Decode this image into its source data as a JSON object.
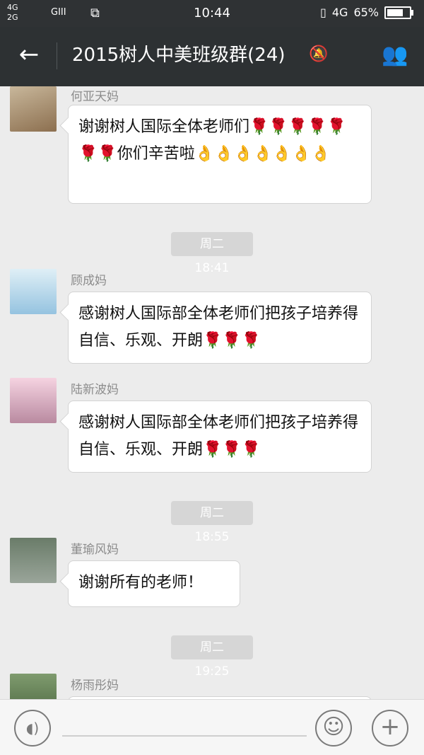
{
  "status": {
    "left_signals": "4G\n2G",
    "gii": "GIII",
    "sim_icon": "sim-icon",
    "time": "10:44",
    "net": "4G",
    "battery": "65%",
    "battery_level": 0.65
  },
  "header": {
    "title": "2015树人中美班级群(24)",
    "back_icon": "arrow-left-icon",
    "mute_icon": "bell-off-icon",
    "group_icon": "group-icon"
  },
  "messages": [
    {
      "sender": "何亚天妈",
      "text": "谢谢树人国际全体老师们🌹🌹🌹🌹🌹🌹🌹你们辛苦啦👌👌👌👌👌👌👌"
    },
    {
      "sender": "顾成妈",
      "text": "感谢树人国际部全体老师们把孩子培养得自信、乐观、开朗🌹🌹🌹"
    },
    {
      "sender": "陆新波妈",
      "text": "感谢树人国际部全体老师们把孩子培养得自信、乐观、开朗🌹🌹🌹"
    },
    {
      "sender": "董瑜风妈",
      "text": "谢谢所有的老师！"
    },
    {
      "sender": "杨雨彤妈",
      "text": ""
    }
  ],
  "timestamps": [
    "周二 18:41",
    "周二 18:55",
    "周二 19:25"
  ],
  "input": {
    "voice_icon": "voice-icon",
    "emoji_icon": "emoji-icon",
    "plus_icon": "plus-icon"
  }
}
